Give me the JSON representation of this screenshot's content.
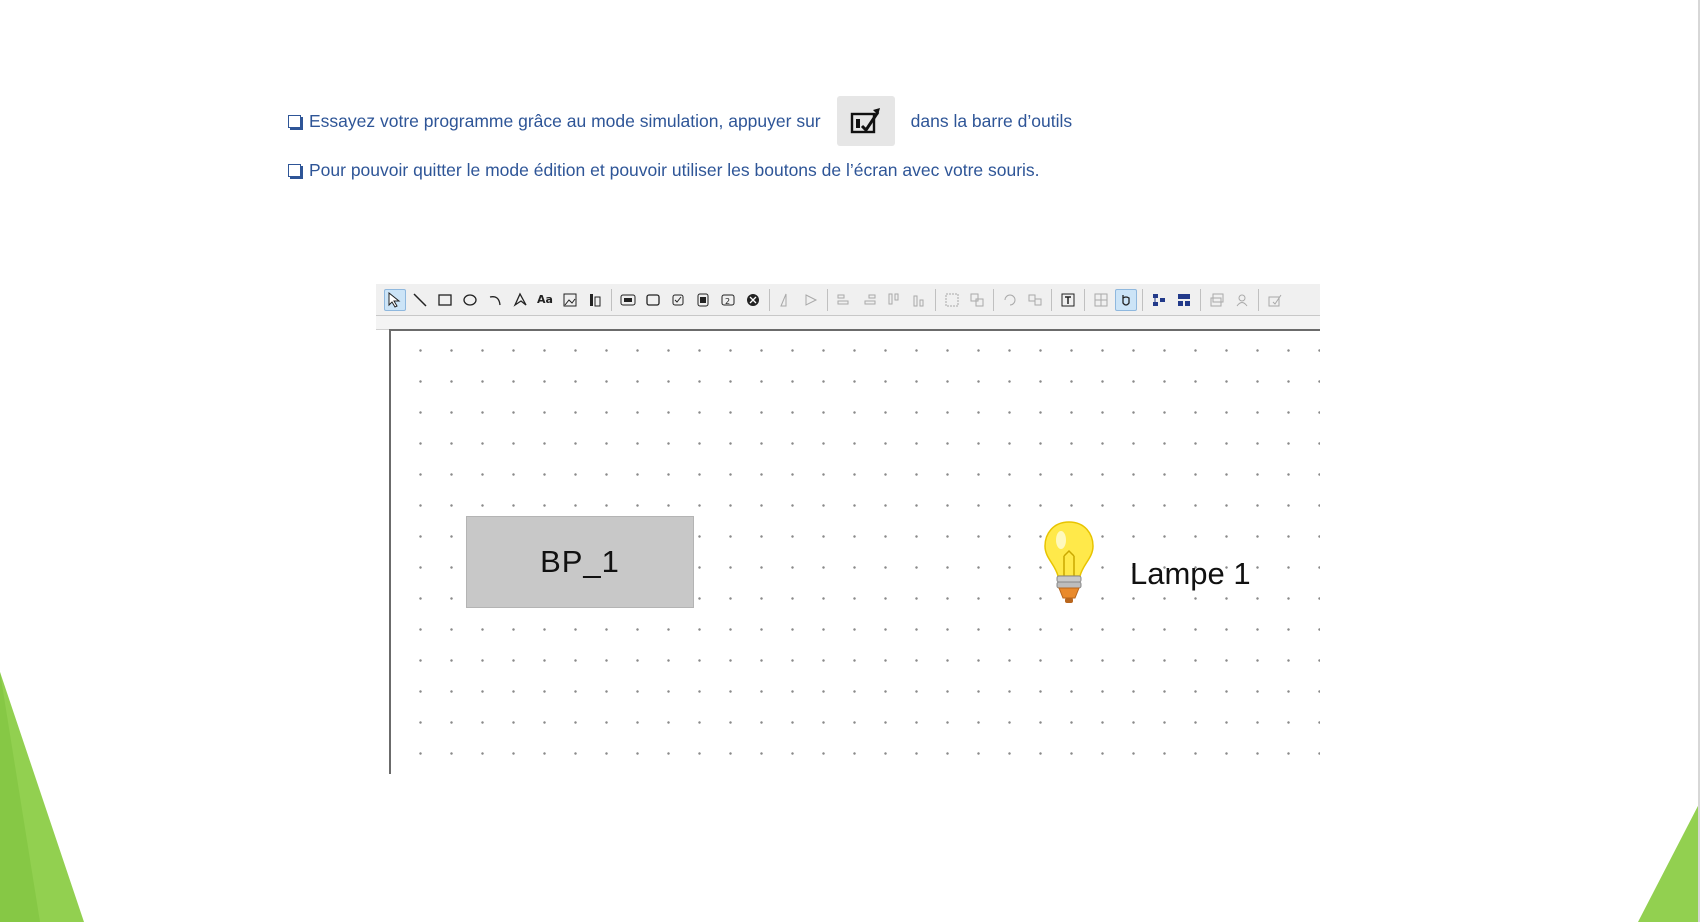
{
  "instructions": {
    "line1_before": "Essayez votre programme grâce au mode simulation, appuyer sur",
    "line1_after": "dans la barre d’outils",
    "line2": "Pour pouvoir quitter le mode édition et pouvoir utiliser les boutons de l’écran avec votre souris."
  },
  "toolbar": {
    "text_tool_label": "Aa"
  },
  "canvas": {
    "button_label": "BP_1",
    "lamp_label": "Lampe 1"
  },
  "colors": {
    "instruction_text": "#2e5597",
    "slide_green": "#92d050",
    "lamp_yellow": "#ffe94a"
  }
}
